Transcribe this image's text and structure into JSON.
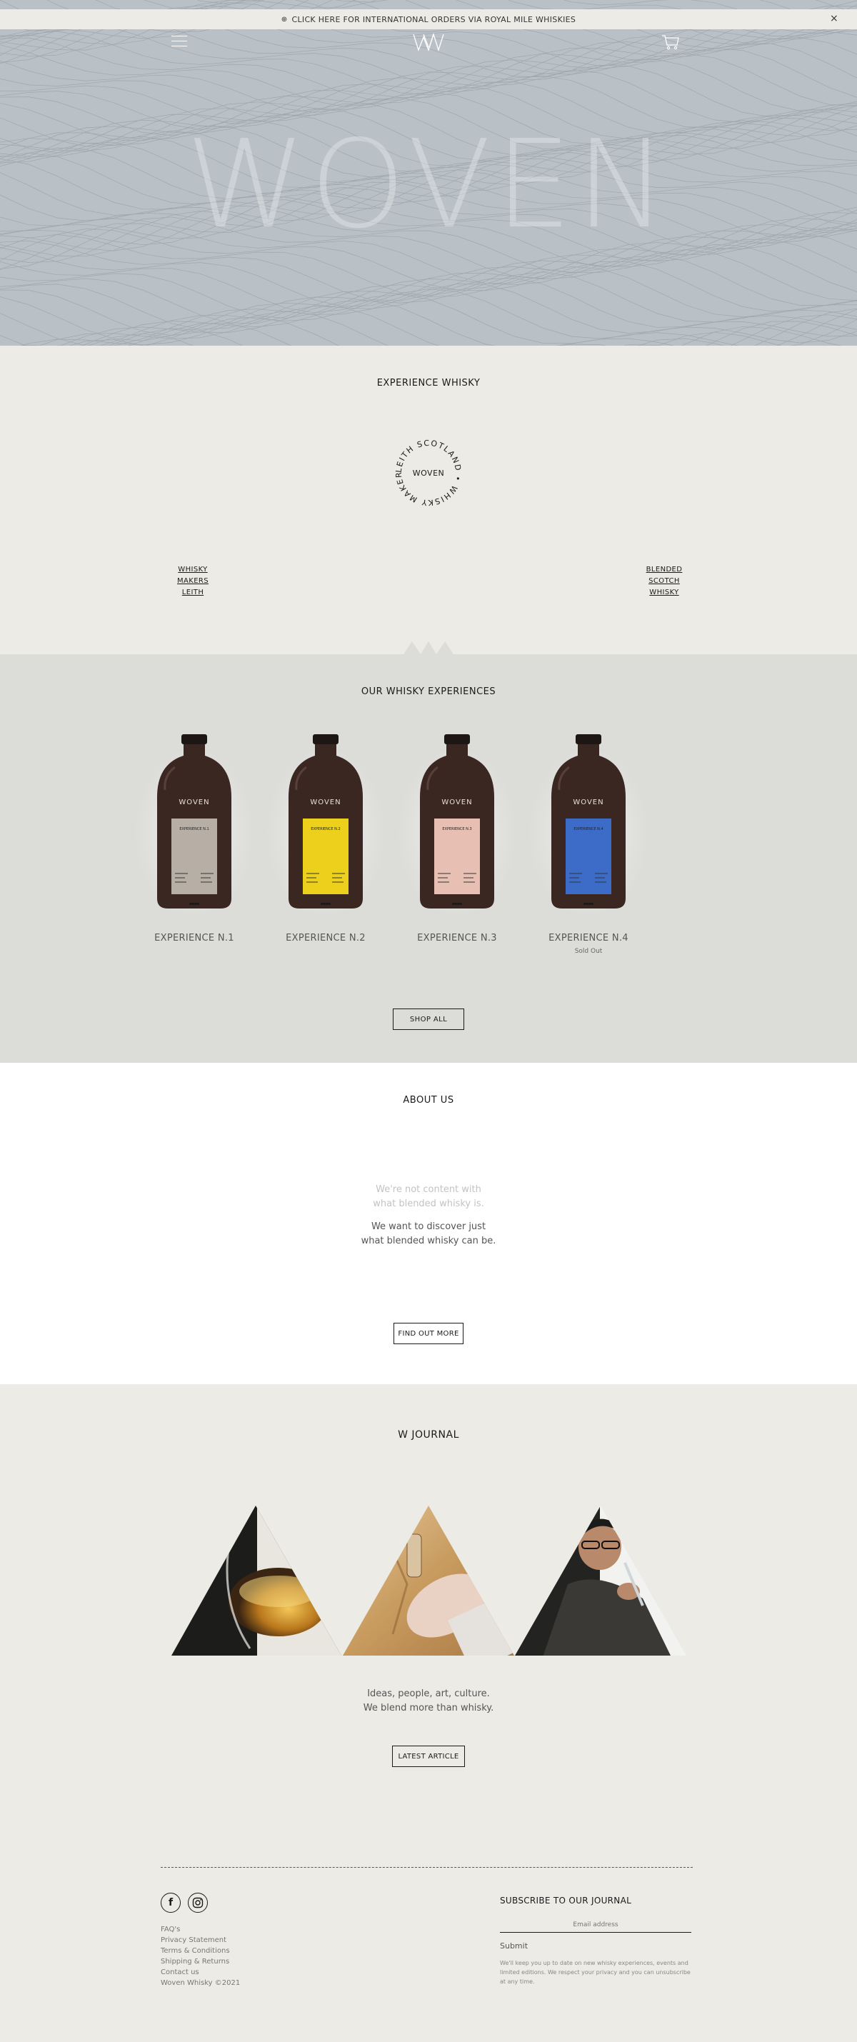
{
  "announcement": {
    "icon": "globe-icon",
    "text": "CLICK HERE FOR INTERNATIONAL ORDERS VIA ROYAL MILE WHISKIES",
    "close": "×"
  },
  "header": {
    "logo": "W",
    "menu_icon": "hamburger-icon",
    "cart_icon": "cart-icon"
  },
  "hero": {
    "word": "WOVEN"
  },
  "experience": {
    "title": "EXPERIENCE WHISKY",
    "badge": {
      "center": "WOVEN",
      "ring": "LEITH SCOTLAND • WHISKY MAKERS •"
    },
    "left_links": [
      "WHISKY",
      "MAKERS",
      "LEITH"
    ],
    "right_links": [
      "BLENDED",
      "SCOTCH",
      "WHISKY"
    ]
  },
  "products": {
    "title": "OUR WHISKY EXPERIENCES",
    "items": [
      {
        "name": "EXPERIENCE N.1",
        "status": "",
        "bottle_brand": "WOVEN",
        "label_text": "EXPERIENCE N.1",
        "label_color": "#b7aea6"
      },
      {
        "name": "EXPERIENCE N.2",
        "status": "",
        "bottle_brand": "WOVEN",
        "label_text": "EXPERIENCE N.2",
        "label_color": "#ecd01c"
      },
      {
        "name": "EXPERIENCE N.3",
        "status": "",
        "bottle_brand": "WOVEN",
        "label_text": "EXPERIENCE N.3",
        "label_color": "#e8bfb3"
      },
      {
        "name": "EXPERIENCE N.4",
        "status": "Sold Out",
        "bottle_brand": "WOVEN",
        "label_text": "EXPERIENCE N.4",
        "label_color": "#3d6cc8"
      }
    ],
    "shop_all": "SHOP ALL"
  },
  "about": {
    "title": "ABOUT US",
    "faded_line1": "We're not content with",
    "faded_line2": "what blended whisky is.",
    "main_line1": "We want to discover just",
    "main_line2": "what blended whisky can be.",
    "button": "FIND OUT MORE"
  },
  "journal": {
    "title": "W JOURNAL",
    "tagline_line1": "Ideas, people, art, culture.",
    "tagline_line2": "We blend more than whisky.",
    "button": "LATEST ARTICLE"
  },
  "footer": {
    "socials": [
      {
        "icon": "facebook-icon",
        "glyph": "f"
      },
      {
        "icon": "instagram-icon",
        "glyph": "◎"
      }
    ],
    "links": [
      "FAQ's",
      "Privacy Statement",
      "Terms & Conditions",
      "Shipping & Returns",
      "Contact us"
    ],
    "copyright": "Woven Whisky ©2021",
    "subscribe": {
      "title": "SUBSCRIBE TO OUR JOURNAL",
      "placeholder": "Email address",
      "submit": "Submit",
      "note": "We'll keep you up to date on new whisky experiences, events and limited editions. We respect your privacy and you can unsubscribe at any time."
    }
  },
  "colors": {
    "background": "#ecebe5",
    "hero": "#b9c0c6",
    "products_bg": "#dcdcd9",
    "about_bg": "#ffffff",
    "bottle": "#3a2722"
  }
}
